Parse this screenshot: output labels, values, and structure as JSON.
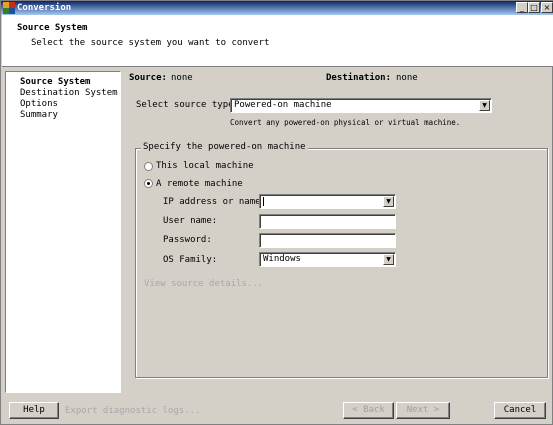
{
  "window": {
    "title": "Conversion",
    "minimize_glyph": "_",
    "maximize_glyph": "□",
    "close_glyph": "×"
  },
  "header": {
    "title": "Source System",
    "subtitle": "Select the source system you want to convert"
  },
  "nav": {
    "items": [
      {
        "label": "Source System",
        "active": true
      },
      {
        "label": "Destination System",
        "active": false
      },
      {
        "label": "Options",
        "active": false
      },
      {
        "label": "Summary",
        "active": false
      }
    ]
  },
  "main": {
    "source_label": "Source:",
    "source_value": "none",
    "destination_label": "Destination:",
    "destination_value": "none",
    "source_type_label": "Select source type:",
    "source_type_value": "Powered-on machine",
    "source_type_help": "Convert any powered-on physical or virtual machine.",
    "group_title": "Specify the powered-on machine",
    "radio_local": "This local machine",
    "radio_remote": "A remote machine",
    "selected_radio": "remote",
    "ip_label": "IP address or name:",
    "ip_value": "",
    "user_label": "User name:",
    "user_value": "",
    "password_label": "Password:",
    "password_value": "",
    "os_label": "OS Family:",
    "os_value": "Windows",
    "view_details": "View source details..."
  },
  "footer": {
    "help": "Help",
    "export_logs": "Export diagnostic logs...",
    "back": "< Back",
    "next": "Next >",
    "cancel": "Cancel"
  },
  "icons": {
    "app": "vmware-converter-icon",
    "dropdown": "chevron-down-icon"
  }
}
